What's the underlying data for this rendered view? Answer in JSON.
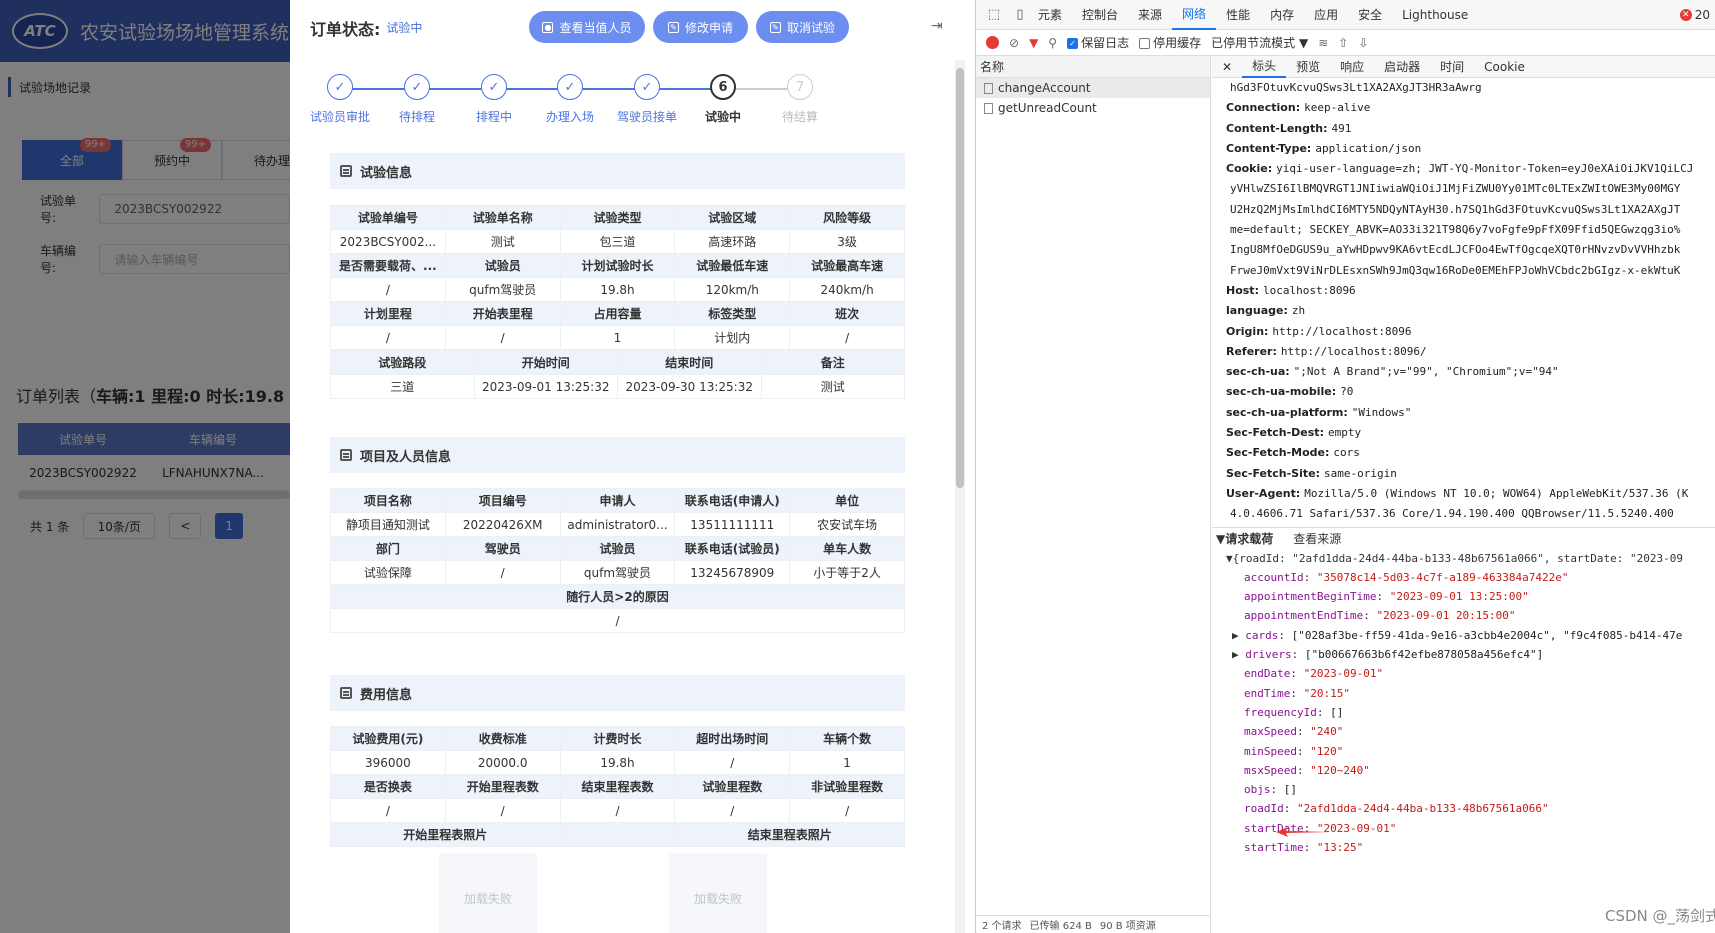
{
  "background": {
    "logo": "ATC",
    "system_title": "农安试验场场地管理系统",
    "nav_title": "试验场地记录",
    "tabs": [
      {
        "label": "全部",
        "badge": "99+"
      },
      {
        "label": "预约中",
        "badge": "99+"
      },
      {
        "label": "待办理",
        "badge": ""
      }
    ],
    "order_no_label": "试验单号:",
    "order_no_value": "2023BCSY002922",
    "vehicle_no_label": "车辆编号:",
    "vehicle_no_placeholder": "请输入车辆编号",
    "list_title_prefix": "订单列表（",
    "list_title_stats": "车辆:1 里程:0 时长:19.8 费",
    "table_headers": [
      "试验单号",
      "车辆编号"
    ],
    "table_row": [
      "2023BCSY002922",
      "LFNAHUNX7NA..."
    ],
    "pager": {
      "total": "共 1 条",
      "page_size": "10条/页",
      "prev": "<",
      "page": "1"
    }
  },
  "modal": {
    "title": "订单状态:",
    "status": "试验中",
    "buttons": {
      "view_staff": "查看当值人员",
      "modify": "修改申请",
      "cancel": "取消试验"
    },
    "logout_icon": "⇥",
    "steps": [
      {
        "label": "试验员审批",
        "state": "done"
      },
      {
        "label": "待排程",
        "state": "done"
      },
      {
        "label": "排程中",
        "state": "done"
      },
      {
        "label": "办理入场",
        "state": "done"
      },
      {
        "label": "驾驶员接单",
        "state": "done"
      },
      {
        "label": "试验中",
        "state": "current",
        "num": "6"
      },
      {
        "label": "待结算",
        "state": "todo",
        "num": "7"
      }
    ],
    "test_info": {
      "title": "试验信息",
      "r1h": [
        "试验单编号",
        "试验单名称",
        "试验类型",
        "试验区域",
        "风险等级"
      ],
      "r1v": [
        "2023BCSY002...",
        "测试",
        "包三道",
        "高速环路",
        "3级"
      ],
      "r2h": [
        "是否需要载荷、...",
        "试验员",
        "计划试验时长",
        "试验最低车速",
        "试验最高车速"
      ],
      "r2v": [
        "/",
        "qufm驾驶员",
        "19.8h",
        "120km/h",
        "240km/h"
      ],
      "r3h": [
        "计划里程",
        "开始表里程",
        "占用容量",
        "标签类型",
        "班次"
      ],
      "r3v": [
        "/",
        "/",
        "1",
        "计划内",
        "/"
      ],
      "r4h": [
        "试验路段",
        "开始时间",
        "结束时间",
        "备注"
      ],
      "r4v": [
        "三道",
        "2023-09-01 13:25:32",
        "2023-09-30 13:25:32",
        "测试"
      ]
    },
    "project_info": {
      "title": "项目及人员信息",
      "r1h": [
        "项目名称",
        "项目编号",
        "申请人",
        "联系电话(申请人)",
        "单位"
      ],
      "r1v": [
        "静项目通知测试",
        "20220426XM",
        "administrator0...",
        "13511111111",
        "农安试车场"
      ],
      "r2h": [
        "部门",
        "驾驶员",
        "试验员",
        "联系电话(试验员)",
        "单车人数"
      ],
      "r2v": [
        "试验保障",
        "/",
        "qufm驾驶员",
        "13245678909",
        "小于等于2人"
      ],
      "r3h": "随行人员>2的原因",
      "r3v": "/"
    },
    "fee_info": {
      "title": "费用信息",
      "r1h": [
        "试验费用(元)",
        "收费标准",
        "计费时长",
        "超时出场时间",
        "车辆个数"
      ],
      "r1v": [
        "396000",
        "20000.0",
        "19.8h",
        "/",
        "1"
      ],
      "r2h": [
        "是否换表",
        "开始里程表数",
        "结束里程表数",
        "试验里程数",
        "非试验里程数"
      ],
      "r2v": [
        "/",
        "/",
        "/",
        "/",
        "/"
      ],
      "photo_h": [
        "开始里程表照片",
        "结束里程表照片"
      ],
      "photo_fail": "加载失败"
    }
  },
  "devtools": {
    "tabs": [
      "元素",
      "控制台",
      "来源",
      "网络",
      "性能",
      "内存",
      "应用",
      "安全",
      "Lighthouse"
    ],
    "active_tab": "网络",
    "errors": "20",
    "toolbar": {
      "preserve_log": "保留日志",
      "disable_cache": "停用缓存",
      "throttle": "已停用节流模式"
    },
    "name_header": "名称",
    "requests": [
      "changeAccount",
      "getUnreadCount"
    ],
    "footer": [
      "2 个请求",
      "已传输 624 B",
      "90 B 项资源"
    ],
    "detail_tabs": [
      "标头",
      "预览",
      "响应",
      "启动器",
      "时间",
      "Cookie"
    ],
    "headers": [
      {
        "k": "",
        "v": "hGd3FOtuvKcvuQSws3Lt1XA2AXgJT3HR3aAwrg"
      },
      {
        "k": "Connection:",
        "v": "keep-alive"
      },
      {
        "k": "Content-Length:",
        "v": "491"
      },
      {
        "k": "Content-Type:",
        "v": "application/json"
      },
      {
        "k": "Cookie:",
        "v": "yiqi-user-language=zh; JWT-YQ-Monitor-Token=eyJ0eXAiOiJKV1QiLCJ"
      },
      {
        "k": "",
        "v": "yVHlwZSI6IlBMQVRGT1JNIiwiaWQiOiJ1MjFiZWU0Yy01MTc0LTExZWItOWE3My00MGY"
      },
      {
        "k": "",
        "v": "U2HzQ2MjMsImlhdCI6MTY5NDQyNTAyH30.h7SQ1hGd3FOtuvKcvuQSws3Lt1XA2AXgJT"
      },
      {
        "k": "",
        "v": "me=default; SECKEY_ABVK=AO33i321T98Q6y7voFgfe9pFfX09Ffid5QEGwzqg3io%"
      },
      {
        "k": "",
        "v": "IngU8MfOeDGUS9u_aYwHDpwv9KA6vtEcdLJCFOo4EwTfOgcqeXQT0rHNvzvDvVVHhzbk"
      },
      {
        "k": "",
        "v": "FrweJ0mVxt9ViNrDLEsxnSWh9JmQ3qw16RoDe0EMEhFPJoWhVCbdc2bGIgz-x-ekWtuK"
      },
      {
        "k": "Host:",
        "v": "localhost:8096"
      },
      {
        "k": "language:",
        "v": "zh"
      },
      {
        "k": "Origin:",
        "v": "http://localhost:8096"
      },
      {
        "k": "Referer:",
        "v": "http://localhost:8096/"
      },
      {
        "k": "sec-ch-ua:",
        "v": "\";Not A Brand\";v=\"99\", \"Chromium\";v=\"94\""
      },
      {
        "k": "sec-ch-ua-mobile:",
        "v": "?0"
      },
      {
        "k": "sec-ch-ua-platform:",
        "v": "\"Windows\""
      },
      {
        "k": "Sec-Fetch-Dest:",
        "v": "empty"
      },
      {
        "k": "Sec-Fetch-Mode:",
        "v": "cors"
      },
      {
        "k": "Sec-Fetch-Site:",
        "v": "same-origin"
      },
      {
        "k": "User-Agent:",
        "v": "Mozilla/5.0 (Windows NT 10.0; WOW64) AppleWebKit/537.36 (K"
      },
      {
        "k": "",
        "v": "4.0.4606.71 Safari/537.36 Core/1.94.190.400 QQBrowser/11.5.5240.400"
      }
    ],
    "payload_title": "请求载荷",
    "view_source": "查看来源",
    "payload_root": "▼{roadId: \"2afd1dda-24d4-44ba-b133-48b67561a066\", startDate: \"2023-09",
    "payload": [
      {
        "k": "accountId",
        "v": "\"35078c14-5d03-4c7f-a189-463384a7422e\""
      },
      {
        "k": "appointmentBeginTime",
        "v": "\"2023-09-01 13:25:00\""
      },
      {
        "k": "appointmentEndTime",
        "v": "\"2023-09-01 20:15:00\""
      },
      {
        "k": "cards",
        "v": "[\"028af3be-ff59-41da-9e16-a3cbb4e2004c\", \"f9c4f085-b414-47e",
        "tri": "▶ "
      },
      {
        "k": "drivers",
        "v": "[\"b00667663b6f42efbe878058a456efc4\"]",
        "tri": "▶ "
      },
      {
        "k": "endDate",
        "v": "\"2023-09-01\""
      },
      {
        "k": "endTime",
        "v": "\"20:15\""
      },
      {
        "k": "frequencyId",
        "v": "[]"
      },
      {
        "k": "maxSpeed",
        "v": "\"240\""
      },
      {
        "k": "minSpeed",
        "v": "\"120\""
      },
      {
        "k": "msxSpeed",
        "v": "\"120~240\""
      },
      {
        "k": "objs",
        "v": "[]"
      },
      {
        "k": "roadId",
        "v": "\"2afd1dda-24d4-44ba-b133-48b67561a066\""
      },
      {
        "k": "startDate",
        "v": "\"2023-09-01\""
      },
      {
        "k": "startTime",
        "v": "\"13:25\""
      }
    ]
  },
  "watermark": "CSDN @_荡剑式_"
}
